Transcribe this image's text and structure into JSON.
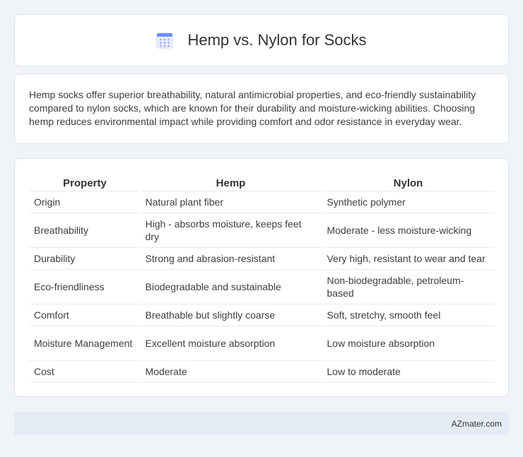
{
  "header": {
    "title": "Hemp vs. Nylon for Socks",
    "icon": "calendar-grid-icon"
  },
  "summary": {
    "text": "Hemp socks offer superior breathability, natural antimicrobial properties, and eco-friendly sustainability compared to nylon socks, which are known for their durability and moisture-wicking abilities. Choosing hemp reduces environmental impact while providing comfort and odor resistance in everyday wear."
  },
  "table": {
    "headers": [
      "Property",
      "Hemp",
      "Nylon"
    ],
    "rows": [
      [
        "Origin",
        "Natural plant fiber",
        "Synthetic polymer"
      ],
      [
        "Breathability",
        "High - absorbs moisture, keeps feet dry",
        "Moderate - less moisture-wicking"
      ],
      [
        "Durability",
        "Strong and abrasion-resistant",
        "Very high, resistant to wear and tear"
      ],
      [
        "Eco-friendliness",
        "Biodegradable and sustainable",
        "Non-biodegradable, petroleum-based"
      ],
      [
        "Comfort",
        "Breathable but slightly coarse",
        "Soft, stretchy, smooth feel"
      ],
      [
        "Moisture Management",
        "Excellent moisture absorption",
        "Low moisture absorption"
      ],
      [
        "Cost",
        "Moderate",
        "Low to moderate"
      ]
    ]
  },
  "footer": {
    "text": "AZmater.com"
  },
  "colors": {
    "background": "#f0f3f8",
    "card": "#ffffff",
    "footer": "#e4ebf5",
    "icon_accent": "#6c8ef5"
  }
}
